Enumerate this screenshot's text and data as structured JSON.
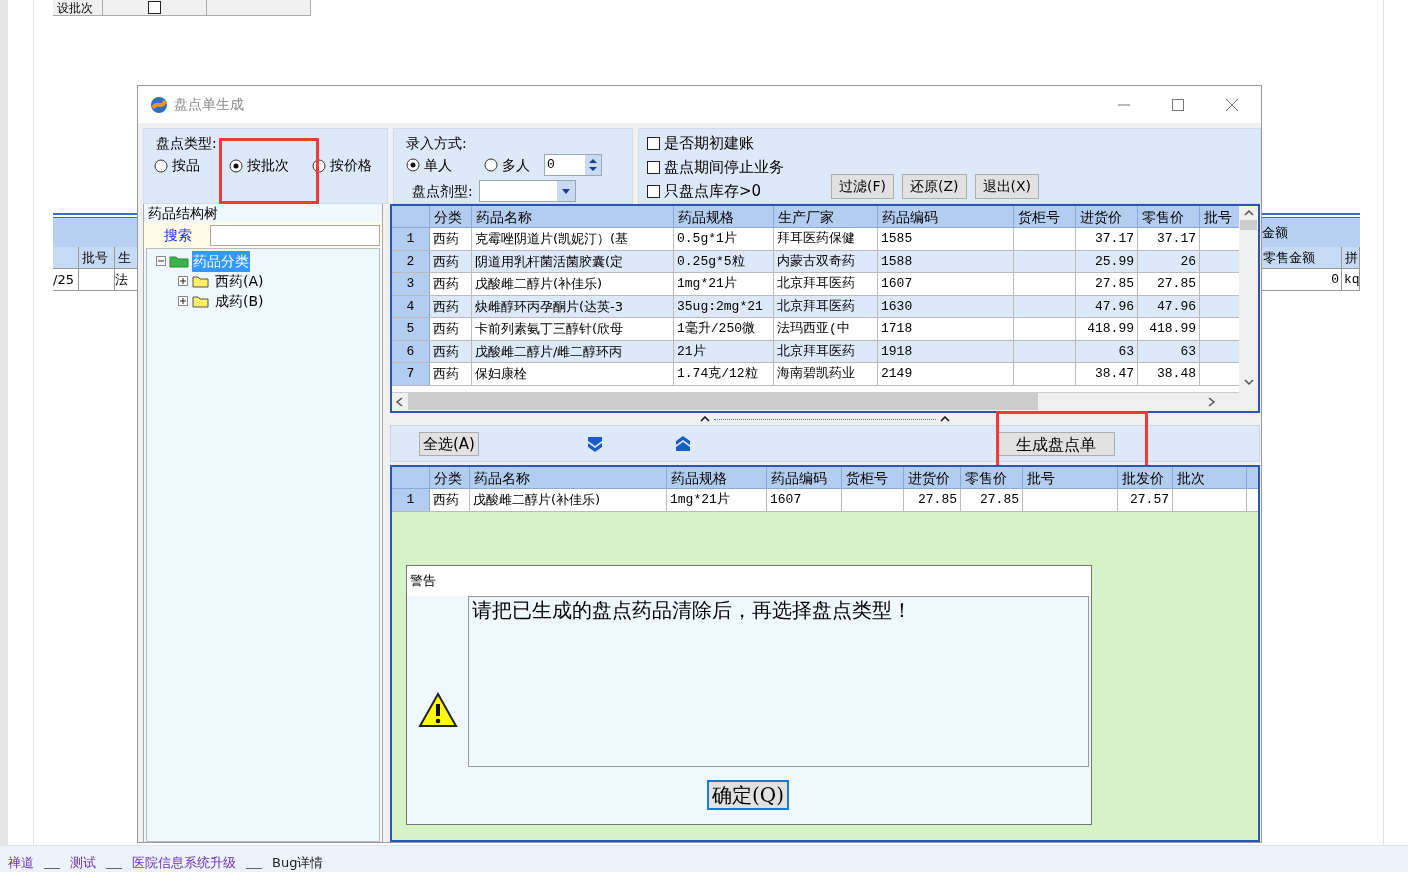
{
  "background": {
    "top_fragment": {
      "label": "设批次",
      "checked": false
    },
    "left_table": {
      "columns": [
        "批号",
        "生"
      ],
      "row": [
        "/25",
        "法"
      ]
    },
    "right_table": {
      "group_header": "金额",
      "columns": [
        "零售金额",
        "拼"
      ],
      "row": [
        "0",
        "kq"
      ]
    },
    "breadcrumbs": [
      "禅道",
      "测试",
      "医院信息系统升级",
      "Bug详情"
    ]
  },
  "window": {
    "title": "盘点单生成"
  },
  "inventory_type": {
    "label": "盘点类型:",
    "options": [
      {
        "label": "按品",
        "selected": false
      },
      {
        "label": "按批次",
        "selected": true
      },
      {
        "label": "按价格",
        "selected": false
      }
    ]
  },
  "entry_mode": {
    "label": "录入方式:",
    "options": [
      {
        "label": "单人",
        "selected": true
      },
      {
        "label": "多人",
        "selected": false
      }
    ],
    "count": "0",
    "dosage_label": "盘点剂型:"
  },
  "options": [
    {
      "label": "是否期初建账",
      "checked": false
    },
    {
      "label": "盘点期间停止业务",
      "checked": false
    },
    {
      "label": "只盘点库存>0",
      "checked": false
    }
  ],
  "top_buttons": [
    "过滤(F)",
    "还原(Z)",
    "退出(X)"
  ],
  "tree": {
    "title": "药品结构树",
    "search_label": "搜索",
    "items": [
      {
        "label": "药品分类",
        "selected": true,
        "expanded": true,
        "children": [
          {
            "label": "西药(A)",
            "selected": false,
            "expanded": false
          },
          {
            "label": "成药(B)",
            "selected": false,
            "expanded": false
          }
        ]
      }
    ]
  },
  "upper_table": {
    "columns": [
      "分类",
      "药品名称",
      "药品规格",
      "生产厂家",
      "药品编码",
      "货柜号",
      "进货价",
      "零售价",
      "批号"
    ],
    "rows": [
      {
        "number": "1",
        "cells": [
          "西药",
          "克霉唑阴道片(凯妮汀）(基",
          "0.5g*1片",
          "拜耳医药保健",
          "1585",
          "",
          "37.17",
          "37.17",
          ""
        ]
      },
      {
        "number": "2",
        "cells": [
          "西药",
          "阴道用乳杆菌活菌胶囊(定",
          "0.25g*5粒",
          "内蒙古双奇药",
          "1588",
          "",
          "25.99",
          "26",
          ""
        ]
      },
      {
        "number": "3",
        "cells": [
          "西药",
          "戊酸雌二醇片(补佳乐)",
          "1mg*21片",
          "北京拜耳医药",
          "1607",
          "",
          "27.85",
          "27.85",
          ""
        ]
      },
      {
        "number": "4",
        "cells": [
          "西药",
          "炔雌醇环丙孕酮片(达英-3",
          "35ug:2mg*21",
          "北京拜耳医药",
          "1630",
          "",
          "47.96",
          "47.96",
          ""
        ]
      },
      {
        "number": "5",
        "cells": [
          "西药",
          "卡前列素氨丁三醇针(欣母",
          "1毫升/250微",
          "法玛西亚(中",
          "1718",
          "",
          "418.99",
          "418.99",
          ""
        ]
      },
      {
        "number": "6",
        "cells": [
          "西药",
          "戊酸雌二醇片/雌二醇环丙",
          "21片",
          "北京拜耳医药",
          "1918",
          "",
          "63",
          "63",
          ""
        ]
      },
      {
        "number": "7",
        "cells": [
          "西药",
          "保妇康栓",
          "1.74克/12粒",
          "海南碧凯药业",
          "2149",
          "",
          "38.47",
          "38.48",
          ""
        ]
      }
    ]
  },
  "select_all_button": "全选(A)",
  "generate_button": "生成盘点单",
  "lower_table": {
    "columns": [
      "分类",
      "药品名称",
      "药品规格",
      "药品编码",
      "货柜号",
      "进货价",
      "零售价",
      "批号",
      "批发价",
      "批次"
    ],
    "rows": [
      {
        "number": "1",
        "cells": [
          "西药",
          "戊酸雌二醇片(补佳乐)",
          "1mg*21片",
          "1607",
          "",
          "27.85",
          "27.85",
          "",
          "27.57",
          ""
        ]
      }
    ]
  },
  "warning": {
    "title": "警告",
    "message": "请把已生成的盘点药品清除后，再选择盘点类型！",
    "button": "确定(Q)"
  }
}
